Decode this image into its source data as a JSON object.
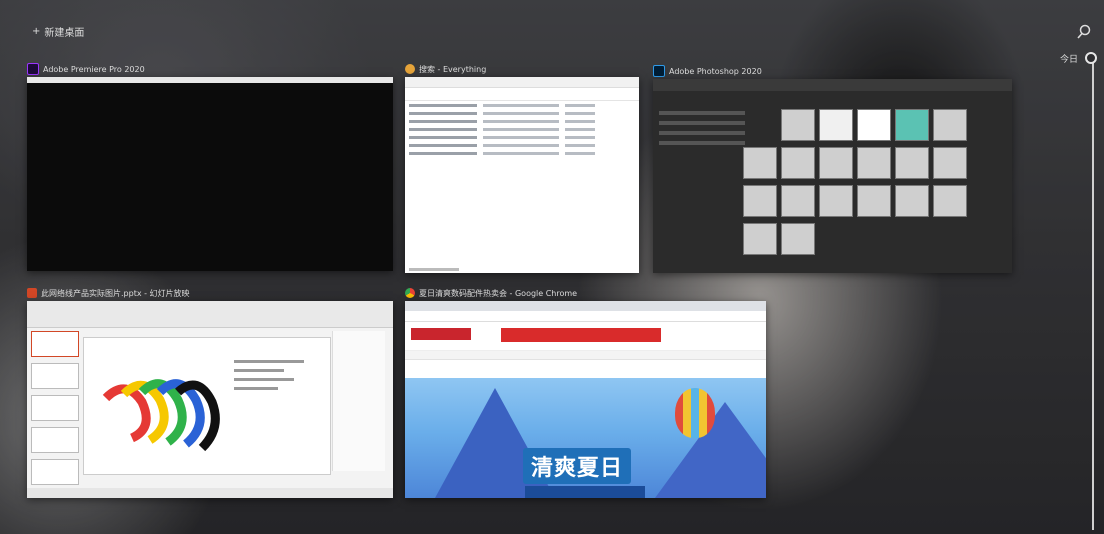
{
  "desktop": {
    "new_desktop_label": "新建桌面",
    "timeline_label": "今日"
  },
  "windows": [
    {
      "title": "Adobe Premiere Pro 2020",
      "app": "premiere"
    },
    {
      "title": "搜索 - Everything",
      "app": "everything"
    },
    {
      "title": "Adobe Photoshop 2020",
      "app": "photoshop"
    },
    {
      "title": "此网络线产品实际图片.pptx - 幻灯片放映",
      "app": "powerpoint"
    },
    {
      "title": "夏日清爽数码配件热卖会 - Google Chrome",
      "app": "chrome"
    }
  ],
  "chrome_page": {
    "banner_headline": "清爽夏日"
  },
  "colors": {
    "premiere": "#9b35ff",
    "everything": "#e6a43a",
    "photoshop": "#2f9ae8",
    "powerpoint": "#d24726",
    "chrome": "#4285f4"
  }
}
